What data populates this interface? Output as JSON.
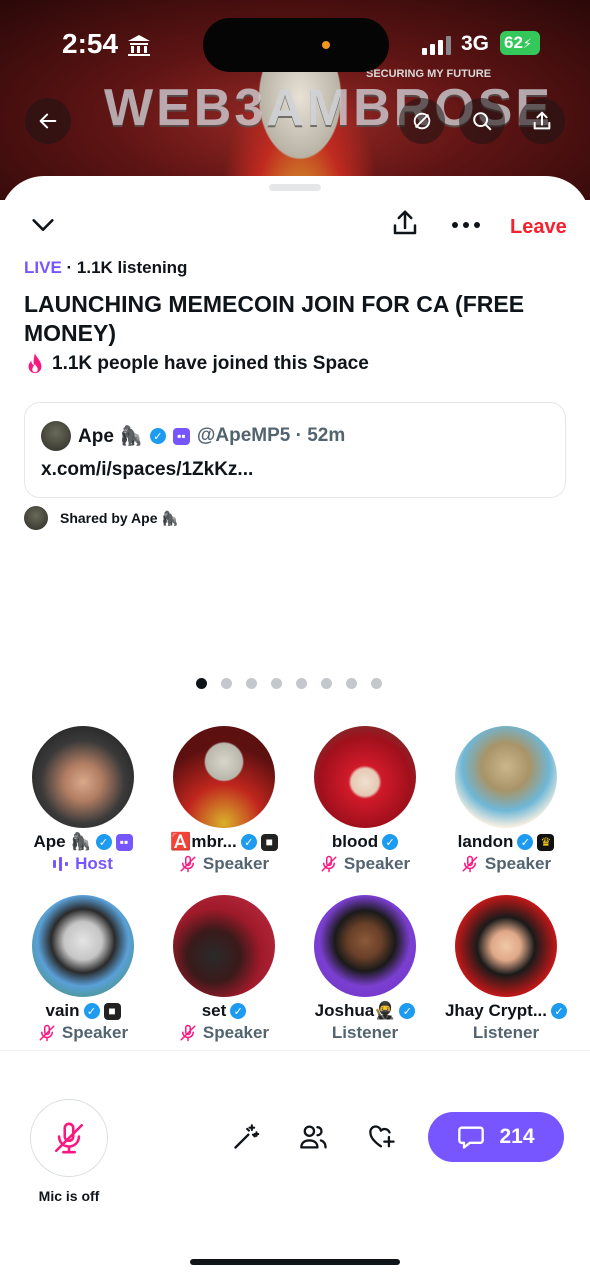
{
  "status_bar": {
    "time": "2:54",
    "network": "3G",
    "battery": "62"
  },
  "banner": {
    "title": "WEB3AMBROSE",
    "subtitle": "SECURING MY FUTURE",
    "badge": "VERIFIED"
  },
  "space": {
    "live_label": "LIVE",
    "listening": "· 1.1K listening",
    "title": "LAUNCHING MEMECOIN JOIN FOR CA (FREE MONEY)",
    "joined": "1.1K people have joined this Space",
    "leave_label": "Leave"
  },
  "tweet": {
    "name": "Ape 🦍",
    "handle": "@ApeMP5 · 52m",
    "link": "x.com/i/spaces/1ZkKz..."
  },
  "shared_by": "Shared by Ape 🦍",
  "pager": {
    "count": 8,
    "active": 0
  },
  "participants": [
    {
      "name": "Ape 🦍",
      "role": "Host",
      "verified": true,
      "badge": "purple"
    },
    {
      "name": "🅰️mbr...",
      "role": "Speaker",
      "verified": true,
      "badge": "dark"
    },
    {
      "name": "blood",
      "role": "Speaker",
      "verified": true,
      "badge": ""
    },
    {
      "name": "landon",
      "role": "Speaker",
      "verified": true,
      "badge": "crown"
    },
    {
      "name": "vain",
      "role": "Speaker",
      "verified": true,
      "badge": "dark"
    },
    {
      "name": "set",
      "role": "Speaker",
      "verified": true,
      "badge": ""
    },
    {
      "name": "Joshua🥷",
      "role": "Listener",
      "verified": true,
      "badge": ""
    },
    {
      "name": "Jhay Crypt...",
      "role": "Listener",
      "verified": true,
      "badge": ""
    }
  ],
  "bottom": {
    "mic_label": "Mic is off",
    "comment_count": "214"
  },
  "colors": {
    "accent": "#7856ff",
    "leave": "#f4212e",
    "verified": "#1d9bf0",
    "mic_off": "#f91880"
  }
}
